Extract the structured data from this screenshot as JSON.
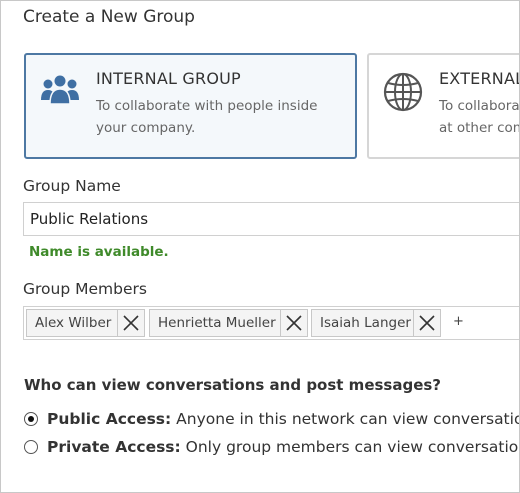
{
  "dialog": {
    "title": "Create a New Group"
  },
  "group_types": {
    "internal": {
      "title": "INTERNAL GROUP",
      "description": "To collaborate with people inside your company.",
      "icon": "people-group-icon",
      "selected": true
    },
    "external": {
      "title": "EXTERNAL",
      "description": "To collabora\nat other com",
      "icon": "globe-icon",
      "selected": false
    }
  },
  "group_name": {
    "label": "Group Name",
    "value": "Public Relations",
    "status": "Name is available."
  },
  "group_members": {
    "label": "Group Members",
    "members": [
      {
        "name": "Alex Wilber"
      },
      {
        "name": "Henrietta Mueller"
      },
      {
        "name": "Isaiah Langer"
      }
    ],
    "add_symbol": "+"
  },
  "privacy": {
    "question": "Who can view conversations and post messages?",
    "options": [
      {
        "title": "Public Access:",
        "description": " Anyone in this network can view conversations",
        "selected": true
      },
      {
        "title": "Private Access:",
        "description": " Only group members can view conversations",
        "selected": false
      }
    ]
  },
  "colors": {
    "accent_border": "#4d78a3",
    "icon_blue": "#3f6fa3",
    "available_green": "#3f8a2a"
  }
}
